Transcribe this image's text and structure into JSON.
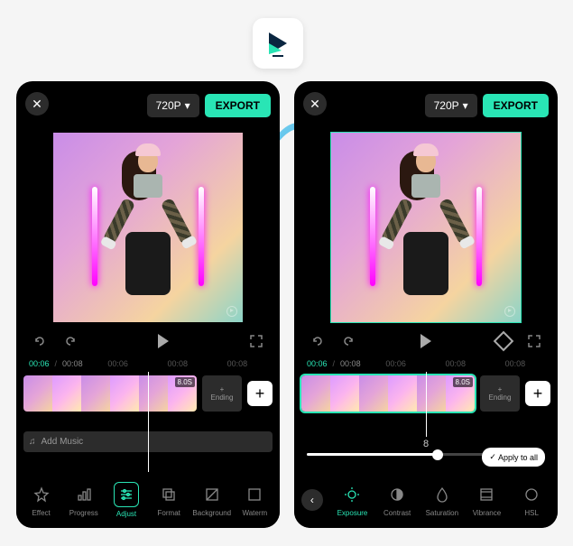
{
  "resolution": "720P",
  "export": "EXPORT",
  "time_current": "00:06",
  "time_total": "00:08",
  "ticks": [
    "00:06",
    "00:08",
    "00:08"
  ],
  "clip_duration": "8.0S",
  "ending": "Ending",
  "add_music": "Add Music",
  "tools_left": [
    "Effect",
    "Progress",
    "Adjust",
    "Format",
    "Background",
    "Waterm"
  ],
  "slider_value": "8",
  "apply_all": "Apply to all",
  "tools_right": [
    "Exposure",
    "Contrast",
    "Saturation",
    "Vibrance",
    "HSL"
  ]
}
